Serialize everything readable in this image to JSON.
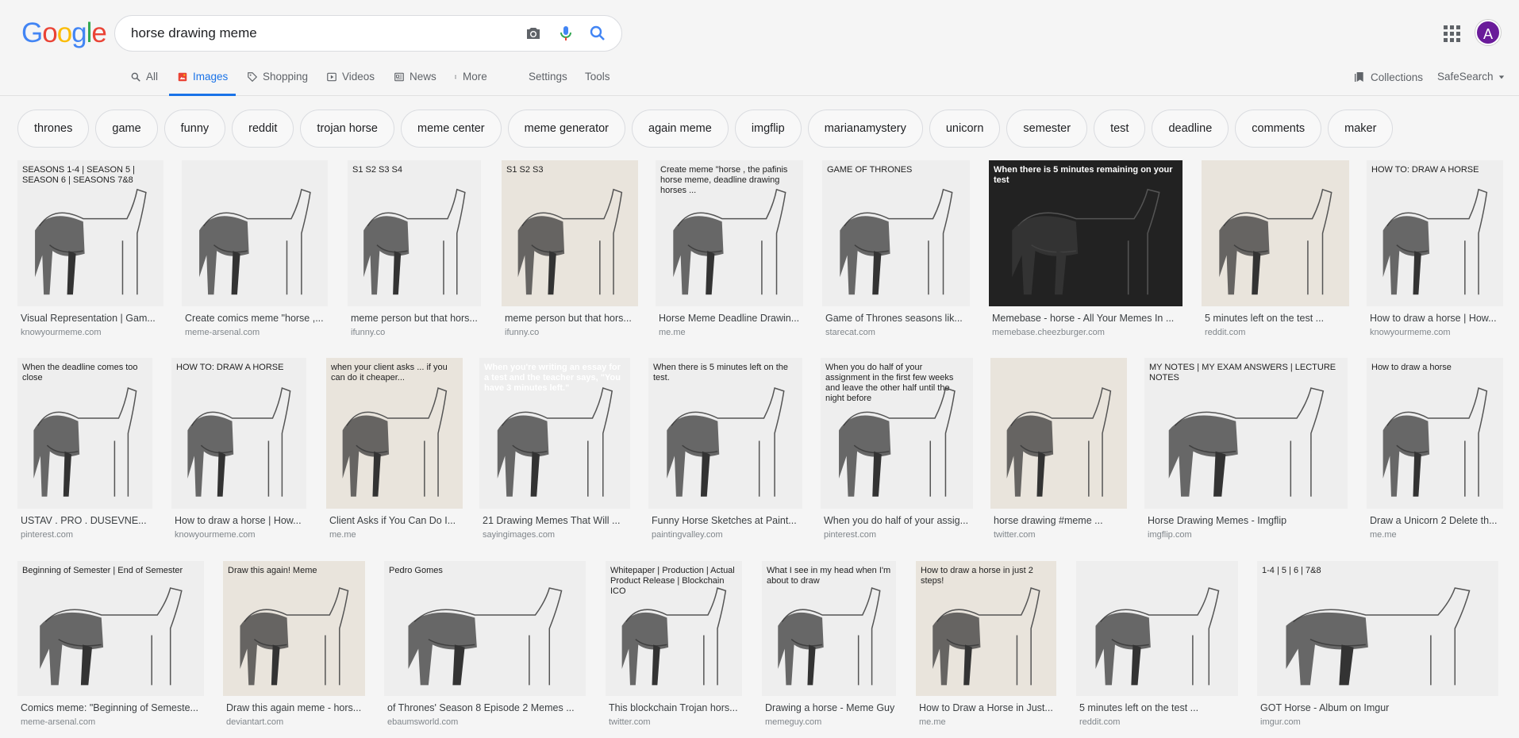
{
  "search": {
    "query": "horse drawing meme"
  },
  "logo": {
    "letters": [
      "G",
      "o",
      "o",
      "g",
      "l",
      "e"
    ],
    "colors": [
      "#4285F4",
      "#EA4335",
      "#FBBC05",
      "#4285F4",
      "#34A853",
      "#EA4335"
    ]
  },
  "account": {
    "avatar_letter": "A"
  },
  "tabs": [
    {
      "label": "All",
      "icon": "search-icon"
    },
    {
      "label": "Images",
      "icon": "image-icon"
    },
    {
      "label": "Shopping",
      "icon": "tag-icon"
    },
    {
      "label": "Videos",
      "icon": "play-icon"
    },
    {
      "label": "News",
      "icon": "news-icon"
    },
    {
      "label": "More",
      "icon": "more-icon"
    },
    {
      "label": "Settings"
    },
    {
      "label": "Tools"
    }
  ],
  "right": {
    "collections": "Collections",
    "safesearch": "SafeSearch"
  },
  "chips": [
    "thrones",
    "game",
    "funny",
    "reddit",
    "trojan horse",
    "meme center",
    "meme generator",
    "again meme",
    "imgflip",
    "marianamystery",
    "unicorn",
    "semester",
    "test",
    "deadline",
    "comments",
    "maker"
  ],
  "rows": [
    [
      {
        "caption": "Visual Representation | Gam...",
        "source": "knowyourmeme.com",
        "thumb_text": "SEASONS 1-4 | SEASON 5 | SEASON 6 | SEASONS 7&8"
      },
      {
        "caption": "Create comics meme \"horse ,...",
        "source": "meme-arsenal.com",
        "thumb_text": ""
      },
      {
        "caption": "meme person but that hors...",
        "source": "ifunny.co",
        "thumb_text": "S1 S2 S3 S4"
      },
      {
        "caption": "meme person but that hors...",
        "source": "ifunny.co",
        "thumb_text": "S1 S2 S3"
      },
      {
        "caption": "Horse Meme Deadline Drawin...",
        "source": "me.me",
        "thumb_text": "Create meme \"horse , the pafinis horse meme, deadline drawing horses ..."
      },
      {
        "caption": "Game of Thrones seasons lik...",
        "source": "starecat.com",
        "thumb_text": "GAME OF THRONES"
      },
      {
        "caption": "Memebase - horse - All Your Memes In ...",
        "source": "memebase.cheezburger.com",
        "thumb_text": "When there is 5 minutes remaining on your test"
      },
      {
        "caption": "5 minutes left on the test ...",
        "source": "reddit.com",
        "thumb_text": ""
      },
      {
        "caption": "How to draw a horse | How...",
        "source": "knowyourmeme.com",
        "thumb_text": "HOW TO: DRAW A HORSE"
      }
    ],
    [
      {
        "caption": "USTAV . PRO . DUSEVNE...",
        "source": "pinterest.com",
        "thumb_text": "When the deadline comes too close"
      },
      {
        "caption": "How to draw a horse | How...",
        "source": "knowyourmeme.com",
        "thumb_text": "HOW TO: DRAW A HORSE"
      },
      {
        "caption": "Client Asks if You Can Do I...",
        "source": "me.me",
        "thumb_text": "when your client asks ... if you can do it cheaper..."
      },
      {
        "caption": "21 Drawing Memes That Will ...",
        "source": "sayingimages.com",
        "thumb_text": "When you're writing an essay for a test and the teacher says, \"You have 3 minutes left.\""
      },
      {
        "caption": "Funny Horse Sketches at Paint...",
        "source": "paintingvalley.com",
        "thumb_text": "When there is 5 minutes left on the test."
      },
      {
        "caption": "When you do half of your assig...",
        "source": "pinterest.com",
        "thumb_text": "When you do half of your assignment in the first few weeks and leave the other half until the night before"
      },
      {
        "caption": "horse drawing #meme ...",
        "source": "twitter.com",
        "thumb_text": ""
      },
      {
        "caption": "Horse Drawing Memes - Imgflip",
        "source": "imgflip.com",
        "thumb_text": "MY NOTES | MY EXAM ANSWERS | LECTURE NOTES"
      },
      {
        "caption": "Draw a Unicorn 2 Delete th...",
        "source": "me.me",
        "thumb_text": "How to draw a horse"
      }
    ],
    [
      {
        "caption": "Comics meme: \"Beginning of Semeste...",
        "source": "meme-arsenal.com",
        "thumb_text": "Beginning of Semester | End of Semester"
      },
      {
        "caption": "Draw this again meme - hors...",
        "source": "deviantart.com",
        "thumb_text": "Draw this again! Meme"
      },
      {
        "caption": "of Thrones' Season 8 Episode 2 Memes ...",
        "source": "ebaumsworld.com",
        "thumb_text": "Pedro Gomes"
      },
      {
        "caption": "This blockchain Trojan hors...",
        "source": "twitter.com",
        "thumb_text": "Whitepaper | Production | Actual Product Release | Blockchain ICO"
      },
      {
        "caption": "Drawing a horse - Meme Guy",
        "source": "memeguy.com",
        "thumb_text": "What I see in my head when I'm about to draw"
      },
      {
        "caption": "How to Draw a Horse in Just...",
        "source": "me.me",
        "thumb_text": "How to draw a horse in just 2 steps!"
      },
      {
        "caption": "5 minutes left on the test ...",
        "source": "reddit.com",
        "thumb_text": ""
      },
      {
        "caption": "GOT Horse - Album on Imgur",
        "source": "imgur.com",
        "thumb_text": "1-4 | 5 | 6 | 7&8"
      }
    ]
  ]
}
